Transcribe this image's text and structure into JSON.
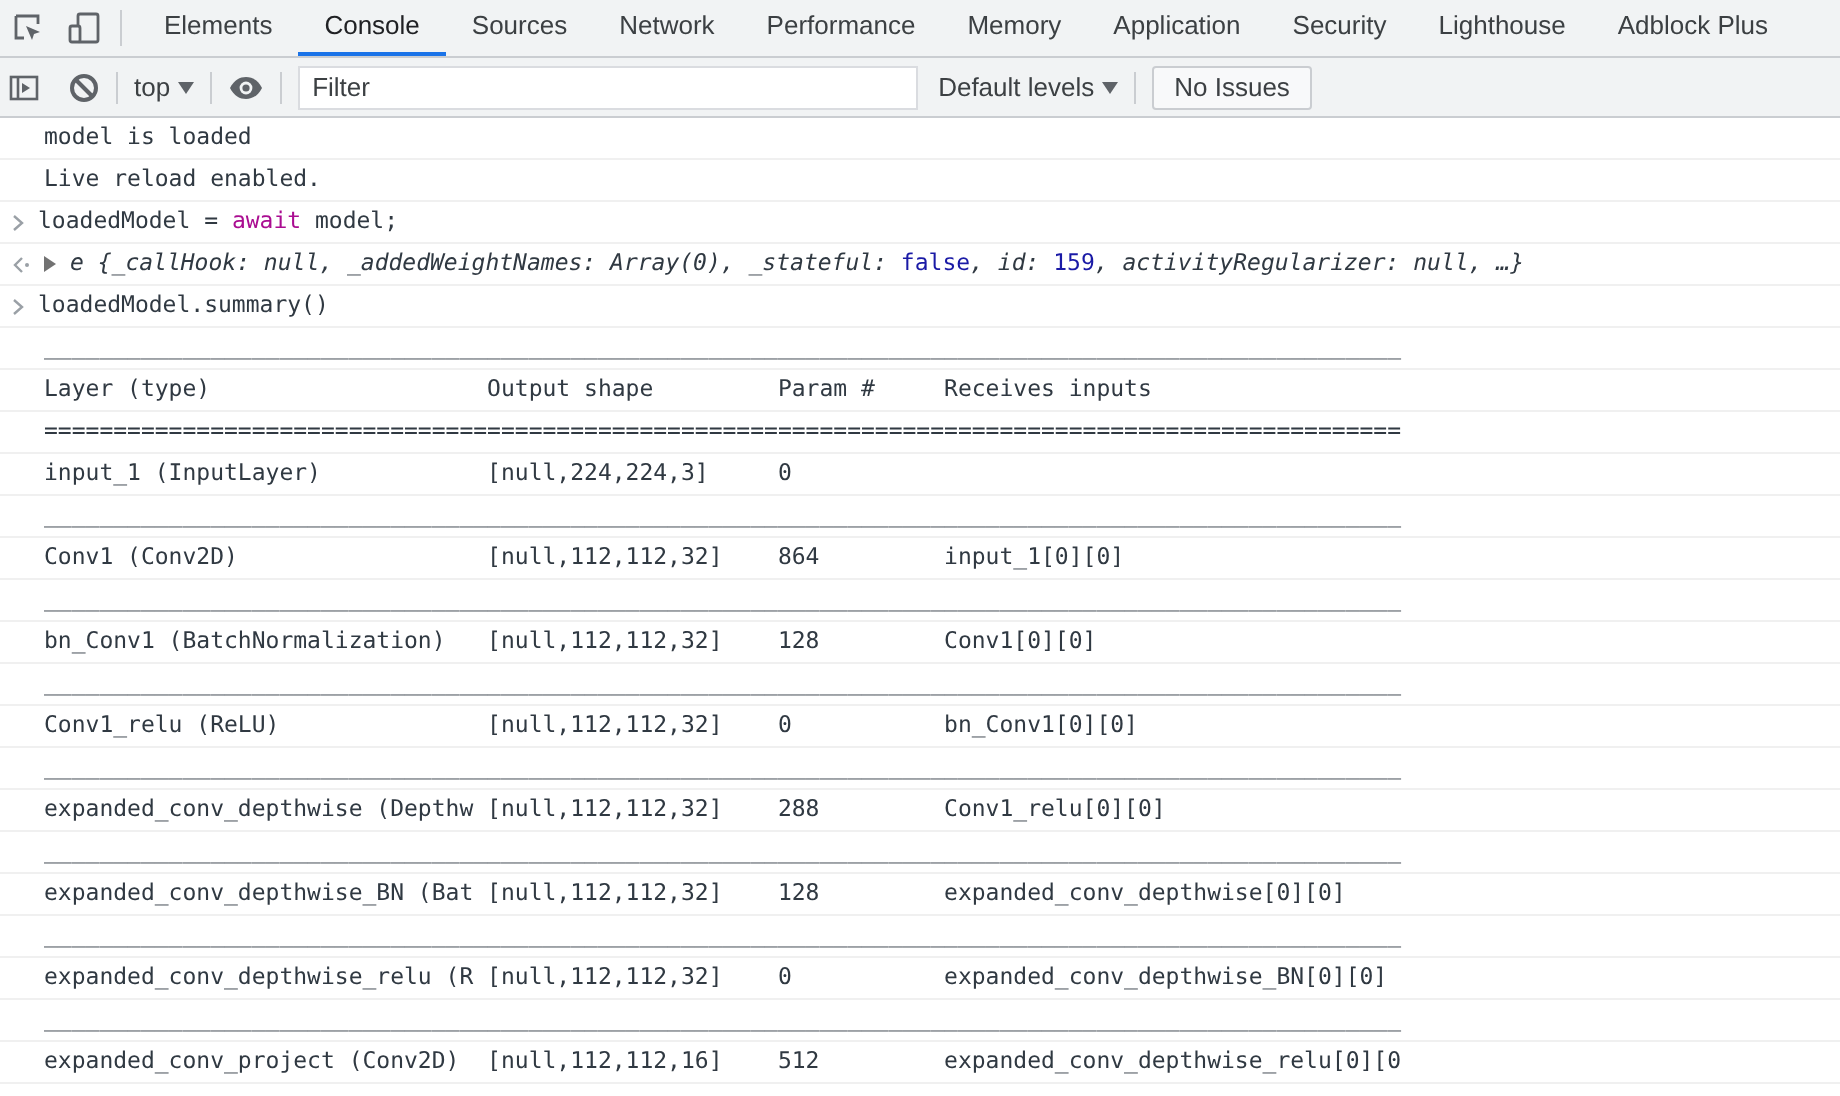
{
  "tabs": [
    {
      "label": "Elements",
      "selected": false
    },
    {
      "label": "Console",
      "selected": true
    },
    {
      "label": "Sources",
      "selected": false
    },
    {
      "label": "Network",
      "selected": false
    },
    {
      "label": "Performance",
      "selected": false
    },
    {
      "label": "Memory",
      "selected": false
    },
    {
      "label": "Application",
      "selected": false
    },
    {
      "label": "Security",
      "selected": false
    },
    {
      "label": "Lighthouse",
      "selected": false
    },
    {
      "label": "Adblock Plus",
      "selected": false
    }
  ],
  "toolbar": {
    "context": "top",
    "filter": {
      "placeholder": "Filter"
    },
    "levels": "Default levels",
    "issues": "No Issues"
  },
  "messages": [
    {
      "kind": "log",
      "segments": [
        {
          "kind": "plain",
          "text": "model is loaded"
        }
      ]
    },
    {
      "kind": "log",
      "segments": [
        {
          "kind": "plain",
          "text": "Live reload enabled."
        }
      ]
    },
    {
      "kind": "input",
      "segments": [
        {
          "kind": "plain",
          "text": "loadedModel = "
        },
        {
          "kind": "keyword",
          "text": "await"
        },
        {
          "kind": "plain",
          "text": " model;"
        }
      ]
    },
    {
      "kind": "result",
      "segments": [
        {
          "kind": "plain",
          "text": "e {_callHook: null, _addedWeightNames: Array(0), _stateful: "
        },
        {
          "kind": "literal",
          "text": "false"
        },
        {
          "kind": "plain",
          "text": ", id: "
        },
        {
          "kind": "literal",
          "text": "159"
        },
        {
          "kind": "plain",
          "text": ", activityRegularizer: null, …}"
        }
      ]
    },
    {
      "kind": "input",
      "segments": [
        {
          "kind": "plain",
          "text": "loadedModel.summary()"
        }
      ]
    },
    {
      "kind": "log",
      "segments": [
        {
          "kind": "plain",
          "text": "__________________________________________________________________________________________________"
        }
      ]
    },
    {
      "kind": "log",
      "segments": [
        {
          "kind": "plain",
          "text": "Layer (type)                    Output shape         Param #     Receives inputs"
        }
      ]
    },
    {
      "kind": "log",
      "segments": [
        {
          "kind": "plain",
          "text": "=================================================================================================="
        }
      ]
    },
    {
      "kind": "log",
      "segments": [
        {
          "kind": "plain",
          "text": "input_1 (InputLayer)            [null,224,224,3]     0"
        }
      ]
    },
    {
      "kind": "log",
      "segments": [
        {
          "kind": "plain",
          "text": "__________________________________________________________________________________________________"
        }
      ]
    },
    {
      "kind": "log",
      "segments": [
        {
          "kind": "plain",
          "text": "Conv1 (Conv2D)                  [null,112,112,32]    864         input_1[0][0]"
        }
      ]
    },
    {
      "kind": "log",
      "segments": [
        {
          "kind": "plain",
          "text": "__________________________________________________________________________________________________"
        }
      ]
    },
    {
      "kind": "log",
      "segments": [
        {
          "kind": "plain",
          "text": "bn_Conv1 (BatchNormalization)   [null,112,112,32]    128         Conv1[0][0]"
        }
      ]
    },
    {
      "kind": "log",
      "segments": [
        {
          "kind": "plain",
          "text": "__________________________________________________________________________________________________"
        }
      ]
    },
    {
      "kind": "log",
      "segments": [
        {
          "kind": "plain",
          "text": "Conv1_relu (ReLU)               [null,112,112,32]    0           bn_Conv1[0][0]"
        }
      ]
    },
    {
      "kind": "log",
      "segments": [
        {
          "kind": "plain",
          "text": "__________________________________________________________________________________________________"
        }
      ]
    },
    {
      "kind": "log",
      "segments": [
        {
          "kind": "plain",
          "text": "expanded_conv_depthwise (Depthw [null,112,112,32]    288         Conv1_relu[0][0]"
        }
      ]
    },
    {
      "kind": "log",
      "segments": [
        {
          "kind": "plain",
          "text": "__________________________________________________________________________________________________"
        }
      ]
    },
    {
      "kind": "log",
      "segments": [
        {
          "kind": "plain",
          "text": "expanded_conv_depthwise_BN (Bat [null,112,112,32]    128         expanded_conv_depthwise[0][0]"
        }
      ]
    },
    {
      "kind": "log",
      "segments": [
        {
          "kind": "plain",
          "text": "__________________________________________________________________________________________________"
        }
      ]
    },
    {
      "kind": "log",
      "segments": [
        {
          "kind": "plain",
          "text": "expanded_conv_depthwise_relu (R [null,112,112,32]    0           expanded_conv_depthwise_BN[0][0]"
        }
      ]
    },
    {
      "kind": "log",
      "segments": [
        {
          "kind": "plain",
          "text": "__________________________________________________________________________________________________"
        }
      ]
    },
    {
      "kind": "log",
      "segments": [
        {
          "kind": "plain",
          "text": "expanded_conv_project (Conv2D)  [null,112,112,16]    512         expanded_conv_depthwise_relu[0][0"
        }
      ]
    }
  ]
}
